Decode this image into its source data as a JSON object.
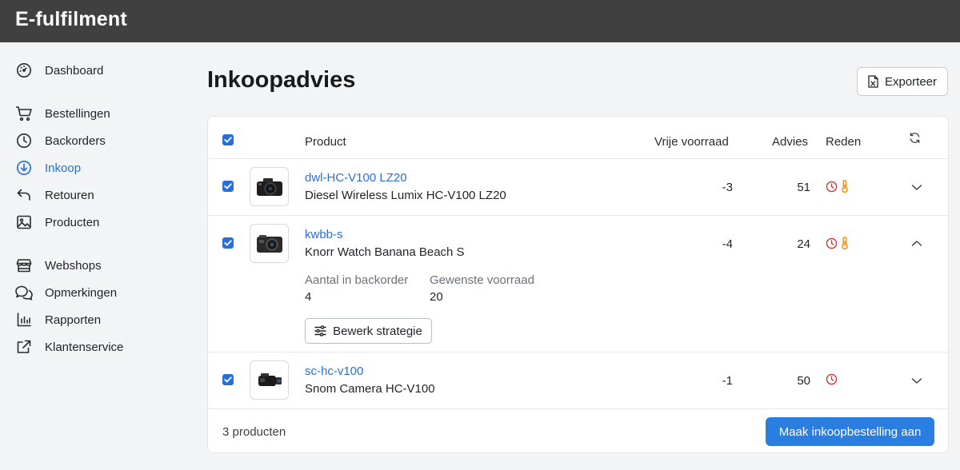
{
  "app": {
    "title": "E-fulfilment"
  },
  "sidebar": {
    "items": [
      {
        "label": "Dashboard",
        "icon": "dashboard-gauge-icon",
        "active": false
      },
      {
        "label": "Bestellingen",
        "icon": "cart-icon",
        "active": false
      },
      {
        "label": "Backorders",
        "icon": "clock-icon",
        "active": false
      },
      {
        "label": "Inkoop",
        "icon": "download-circle-icon",
        "active": true
      },
      {
        "label": "Retouren",
        "icon": "return-arrow-icon",
        "active": false
      },
      {
        "label": "Producten",
        "icon": "image-icon",
        "active": false
      },
      {
        "label": "Webshops",
        "icon": "store-icon",
        "active": false
      },
      {
        "label": "Opmerkingen",
        "icon": "chat-bubbles-icon",
        "active": false
      },
      {
        "label": "Rapporten",
        "icon": "bar-chart-icon",
        "active": false
      },
      {
        "label": "Klantenservice",
        "icon": "external-link-icon",
        "active": false
      }
    ]
  },
  "header": {
    "title": "Inkoopadvies",
    "export_label": "Exporteer"
  },
  "table": {
    "columns": {
      "product": "Product",
      "free_stock": "Vrije voorraad",
      "advice": "Advies",
      "reason": "Reden"
    },
    "rows": [
      {
        "sku": "dwl-HC-V100 LZ20",
        "name": "Diesel Wireless Lumix HC-V100 LZ20",
        "free_stock": "-3",
        "advice": "51",
        "reasons": [
          "clock-icon",
          "thermometer-icon"
        ],
        "expanded": false,
        "checked": true
      },
      {
        "sku": "kwbb-s",
        "name": "Knorr Watch Banana Beach S",
        "free_stock": "-4",
        "advice": "24",
        "reasons": [
          "clock-icon",
          "thermometer-icon"
        ],
        "expanded": true,
        "checked": true,
        "details": {
          "backorder_label": "Aantal in backorder",
          "backorder_value": "4",
          "desired_label": "Gewenste voorraad",
          "desired_value": "20",
          "edit_strategy_label": "Bewerk strategie"
        }
      },
      {
        "sku": "sc-hc-v100",
        "name": "Snom Camera HC-V100",
        "free_stock": "-1",
        "advice": "50",
        "reasons": [
          "clock-icon"
        ],
        "expanded": false,
        "checked": true
      }
    ]
  },
  "footer": {
    "count_label": "3 producten",
    "create_order_label": "Maak inkoopbestelling aan"
  },
  "colors": {
    "topbar": "#404040",
    "accent": "#2a6ed8",
    "primary_button": "#2a7de1",
    "reason_clock": "#e03131",
    "reason_thermo": "#f08c00"
  }
}
